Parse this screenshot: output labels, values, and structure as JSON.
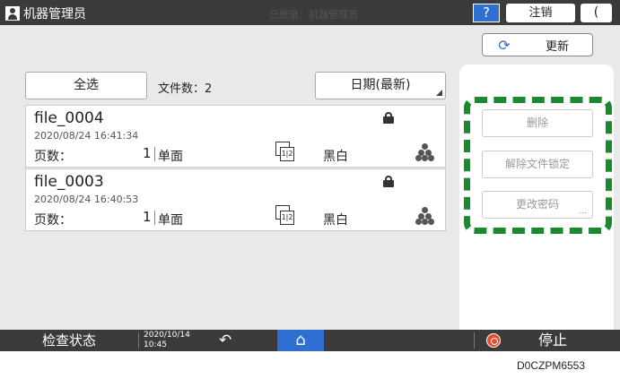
{
  "header": {
    "user_label": "机器管理员",
    "center_message": "已登录：机器管理员",
    "help_label": "?",
    "logout_label": "注销",
    "moon_label": "("
  },
  "toolbar": {
    "refresh_label": "更新",
    "select_all_label": "全选",
    "file_count_label": "文件数：2",
    "sort_label": "日期(最新)"
  },
  "files": [
    {
      "name": "file_0004",
      "date": "2020/08/24 16:41:34",
      "pages_label": "页数：",
      "pages": "1",
      "sides": "单面",
      "duplex_page": "1|2",
      "color": "黑白"
    },
    {
      "name": "file_0003",
      "date": "2020/08/24 16:40:53",
      "pages_label": "页数：",
      "pages": "1",
      "sides": "单面",
      "duplex_page": "1|2",
      "color": "黑白"
    }
  ],
  "right_panel": {
    "delete_label": "删除",
    "unlock_label": "解除文件锁定",
    "change_password_label": "更改密码",
    "more_dots": "..."
  },
  "bottom_bar": {
    "check_status_label": "检查状态",
    "date": "2020/10/14",
    "time": "10:45",
    "back_icon": "↶",
    "home_icon": "⌂",
    "stop_label": "停止"
  },
  "figure_code": "D0CZPM6553",
  "colors": {
    "accent_blue": "#2f6fd1",
    "highlight_green": "#1a8a2e",
    "stop_red": "#e8502e",
    "bar_dark": "#3b3b3b"
  }
}
